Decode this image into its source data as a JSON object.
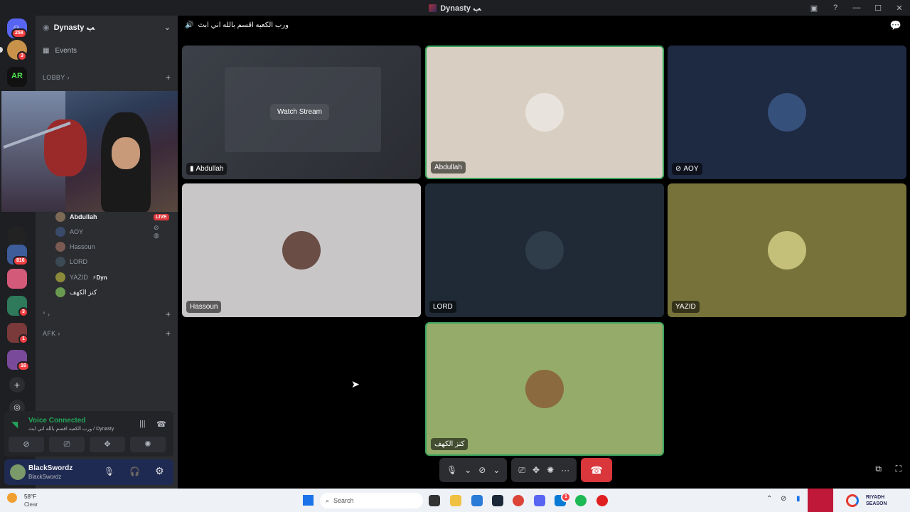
{
  "window": {
    "title": "Dynasty ﭗ"
  },
  "server": {
    "name": "Dynasty ﭗ",
    "events_label": "Events",
    "categories": [
      {
        "label": "LOBBY",
        "chev": "›"
      },
      {
        "label": "°",
        "chev": "›"
      },
      {
        "label": "AFK",
        "chev": "›"
      }
    ]
  },
  "rail": {
    "badges": [
      "258",
      "3",
      "816",
      "3",
      "1",
      "16"
    ],
    "logo_text": "AR"
  },
  "voice_channel": {
    "users": [
      {
        "name": "Abdullah",
        "live": "LIVE",
        "color": "#7d6a56"
      },
      {
        "name": "AOY",
        "color": "#3a4a6a"
      },
      {
        "name": "Hassoun",
        "color": "#7a5a52"
      },
      {
        "name": "LORD",
        "color": "#3c4a55"
      },
      {
        "name": "YAZID",
        "tag": "Dyn",
        "color": "#8a8a3a"
      },
      {
        "name": "كنز الكهف",
        "color": "#6a9a50"
      }
    ]
  },
  "header": {
    "channel": "ورب الكعبه اقسم بالله اني ابث"
  },
  "stage": {
    "tiles": [
      {
        "name": "Abdullah",
        "kind": "stream",
        "cta": "Watch Stream"
      },
      {
        "name": "Abdullah",
        "bg": "#d8cfc2",
        "avatar": "#e8e4dd",
        "speaking": true
      },
      {
        "name": "AOY",
        "bg": "#1e2942",
        "avatar": "#35507a",
        "muted_icon": "video-off"
      },
      {
        "name": "Hassoun",
        "bg": "#c9c6c8",
        "avatar": "#6a4e45"
      },
      {
        "name": "LORD",
        "bg": "#1f2a36",
        "avatar": "#2f3d4a"
      },
      {
        "name": "YAZID",
        "bg": "#76723a",
        "avatar": "#c4c07a"
      },
      {
        "name": "كنز الكهف",
        "bg": "#95ab6a",
        "avatar": "#8a6a3e",
        "speaking": true
      }
    ]
  },
  "voice_panel": {
    "status": "Voice Connected",
    "channel": "ورب الكعبه اقسم بالله اني ابث / Dynasty ﭗ"
  },
  "user_panel": {
    "username": "BlackSwordz",
    "sub": "BlackSwordz"
  },
  "taskbar": {
    "temp": "58°F",
    "weather": "Clear",
    "search": "Search",
    "brand_line1": "RIYADH",
    "brand_line2": "SEASON",
    "mail_badge": "1"
  },
  "colors": {
    "accent": "#5865f2",
    "speaking": "#3ba55d",
    "danger": "#da373c",
    "voice_green": "#23a559"
  }
}
